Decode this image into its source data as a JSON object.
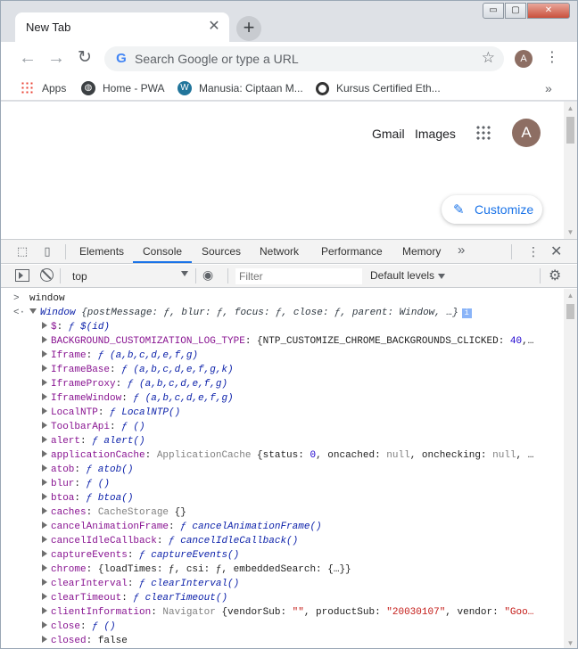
{
  "tab": {
    "title": "New Tab",
    "close": "✕",
    "new_tab": "+"
  },
  "window_controls": {
    "minimize": "▭",
    "maximize": "▢",
    "close": "✕"
  },
  "toolbar": {
    "back": "←",
    "forward": "→",
    "reload": "↻",
    "omnibox_placeholder": "Search Google or type a URL",
    "star": "☆",
    "profile_initial": "A",
    "menu": "⋮"
  },
  "bookmarks": [
    {
      "label": "Apps",
      "icon": "apps-grid-icon"
    },
    {
      "label": "Home - PWA",
      "icon": "globe-icon"
    },
    {
      "label": "Manusia: Ciptaan M...",
      "icon": "wordpress-icon"
    },
    {
      "label": "Kursus Certified Eth...",
      "icon": "ring-icon"
    }
  ],
  "bookmarks_more": "»",
  "newtab_page": {
    "gmail": "Gmail",
    "images": "Images",
    "avatar_initial": "A",
    "customize": "Customize"
  },
  "devtools": {
    "tabs": [
      "Elements",
      "Console",
      "Sources",
      "Network",
      "Performance",
      "Memory"
    ],
    "active_tab": "Console",
    "more": "»",
    "menu": "⋮",
    "close": "✕",
    "context": "top",
    "filter_placeholder": "Filter",
    "levels": "Default levels",
    "gear": "⚙"
  },
  "console": {
    "input": "window",
    "summary": {
      "label": "Window",
      "preview": " {postMessage: ƒ, blur: ƒ, focus: ƒ, close: ƒ, parent: Window, …}"
    },
    "rows": [
      {
        "key": "$",
        "segs": [
          [
            "fn",
            "ƒ $(id)"
          ]
        ]
      },
      {
        "key": "BACKGROUND_CUSTOMIZATION_LOG_TYPE",
        "segs": [
          [
            "plain",
            "{NTP_CUSTOMIZE_CHROME_BACKGROUNDS_CLICKED: "
          ],
          [
            "num",
            "40"
          ],
          [
            "plain",
            ",…"
          ]
        ]
      },
      {
        "key": "Iframe",
        "segs": [
          [
            "fn",
            "ƒ (a,b,c,d,e,f,g)"
          ]
        ]
      },
      {
        "key": "IframeBase",
        "segs": [
          [
            "fn",
            "ƒ (a,b,c,d,e,f,g,k)"
          ]
        ]
      },
      {
        "key": "IframeProxy",
        "segs": [
          [
            "fn",
            "ƒ (a,b,c,d,e,f,g)"
          ]
        ]
      },
      {
        "key": "IframeWindow",
        "segs": [
          [
            "fn",
            "ƒ (a,b,c,d,e,f,g)"
          ]
        ]
      },
      {
        "key": "LocalNTP",
        "segs": [
          [
            "fn",
            "ƒ LocalNTP()"
          ]
        ]
      },
      {
        "key": "ToolbarApi",
        "segs": [
          [
            "fn",
            "ƒ ()"
          ]
        ]
      },
      {
        "key": "alert",
        "segs": [
          [
            "fn",
            "ƒ alert()"
          ]
        ]
      },
      {
        "key": "applicationCache",
        "segs": [
          [
            "nul",
            "ApplicationCache "
          ],
          [
            "plain",
            "{status: "
          ],
          [
            "num",
            "0"
          ],
          [
            "plain",
            ", oncached: "
          ],
          [
            "nul",
            "null"
          ],
          [
            "plain",
            ", onchecking: "
          ],
          [
            "nul",
            "null"
          ],
          [
            "plain",
            ", …"
          ]
        ]
      },
      {
        "key": "atob",
        "segs": [
          [
            "fn",
            "ƒ atob()"
          ]
        ]
      },
      {
        "key": "blur",
        "segs": [
          [
            "fn",
            "ƒ ()"
          ]
        ]
      },
      {
        "key": "btoa",
        "segs": [
          [
            "fn",
            "ƒ btoa()"
          ]
        ]
      },
      {
        "key": "caches",
        "segs": [
          [
            "nul",
            "CacheStorage "
          ],
          [
            "plain",
            "{}"
          ]
        ]
      },
      {
        "key": "cancelAnimationFrame",
        "segs": [
          [
            "fn",
            "ƒ cancelAnimationFrame()"
          ]
        ]
      },
      {
        "key": "cancelIdleCallback",
        "segs": [
          [
            "fn",
            "ƒ cancelIdleCallback()"
          ]
        ]
      },
      {
        "key": "captureEvents",
        "segs": [
          [
            "fn",
            "ƒ captureEvents()"
          ]
        ]
      },
      {
        "key": "chrome",
        "segs": [
          [
            "plain",
            "{loadTimes: ƒ, csi: ƒ, embeddedSearch: {…}}"
          ]
        ]
      },
      {
        "key": "clearInterval",
        "segs": [
          [
            "fn",
            "ƒ clearInterval()"
          ]
        ]
      },
      {
        "key": "clearTimeout",
        "segs": [
          [
            "fn",
            "ƒ clearTimeout()"
          ]
        ]
      },
      {
        "key": "clientInformation",
        "segs": [
          [
            "nul",
            "Navigator "
          ],
          [
            "plain",
            "{vendorSub: "
          ],
          [
            "str",
            "\"\""
          ],
          [
            "plain",
            ", productSub: "
          ],
          [
            "str",
            "\"20030107\""
          ],
          [
            "plain",
            ", vendor: "
          ],
          [
            "str",
            "\"Goo…"
          ]
        ]
      },
      {
        "key": "close",
        "segs": [
          [
            "fn",
            "ƒ ()"
          ]
        ]
      },
      {
        "key": "closed",
        "segs": [
          [
            "plain",
            "false"
          ]
        ]
      }
    ]
  },
  "colors": {
    "accent": "#1a73e8",
    "console_key": "#881391",
    "console_fn": "#0d22aa",
    "console_string": "#c41a16",
    "console_number": "#1c00cf"
  }
}
